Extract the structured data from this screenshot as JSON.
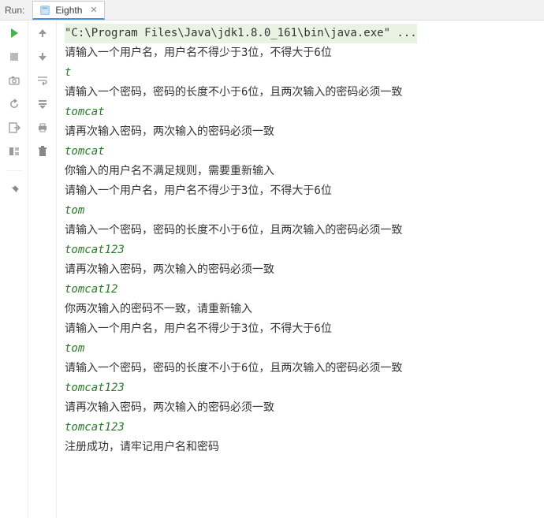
{
  "header": {
    "run_label": "Run:",
    "tab_title": "Eighth"
  },
  "toolbar_left": {
    "run": "run",
    "stop": "stop",
    "camera": "camera",
    "restart": "restart",
    "exit": "exit",
    "layout": "layout",
    "pin": "pin"
  },
  "toolbar_right": {
    "up": "up",
    "down": "down",
    "wrap": "wrap",
    "scroll_end": "scroll-to-end",
    "print": "print",
    "trash": "trash"
  },
  "console": {
    "lines": [
      {
        "type": "cmd",
        "text": "\"C:\\Program Files\\Java\\jdk1.8.0_161\\bin\\java.exe\" ..."
      },
      {
        "type": "output",
        "text": "请输入一个用户名，用户名不得少于3位，不得大于6位"
      },
      {
        "type": "input",
        "text": "t"
      },
      {
        "type": "output",
        "text": "请输入一个密码，密码的长度不小于6位，且两次输入的密码必须一致"
      },
      {
        "type": "input",
        "text": "tomcat"
      },
      {
        "type": "output",
        "text": "请再次输入密码，两次输入的密码必须一致"
      },
      {
        "type": "input",
        "text": "tomcat"
      },
      {
        "type": "output",
        "text": "你输入的用户名不满足规则，需要重新输入"
      },
      {
        "type": "output",
        "text": "请输入一个用户名，用户名不得少于3位，不得大于6位"
      },
      {
        "type": "input",
        "text": "tom"
      },
      {
        "type": "output",
        "text": "请输入一个密码，密码的长度不小于6位，且两次输入的密码必须一致"
      },
      {
        "type": "input",
        "text": "tomcat123"
      },
      {
        "type": "output",
        "text": "请再次输入密码，两次输入的密码必须一致"
      },
      {
        "type": "input",
        "text": "tomcat12"
      },
      {
        "type": "output",
        "text": "你两次输入的密码不一致，请重新输入"
      },
      {
        "type": "output",
        "text": "请输入一个用户名，用户名不得少于3位，不得大于6位"
      },
      {
        "type": "input",
        "text": "tom"
      },
      {
        "type": "output",
        "text": "请输入一个密码，密码的长度不小于6位，且两次输入的密码必须一致"
      },
      {
        "type": "input",
        "text": "tomcat123"
      },
      {
        "type": "output",
        "text": "请再次输入密码，两次输入的密码必须一致"
      },
      {
        "type": "input",
        "text": "tomcat123"
      },
      {
        "type": "output",
        "text": "注册成功，请牢记用户名和密码"
      }
    ]
  }
}
